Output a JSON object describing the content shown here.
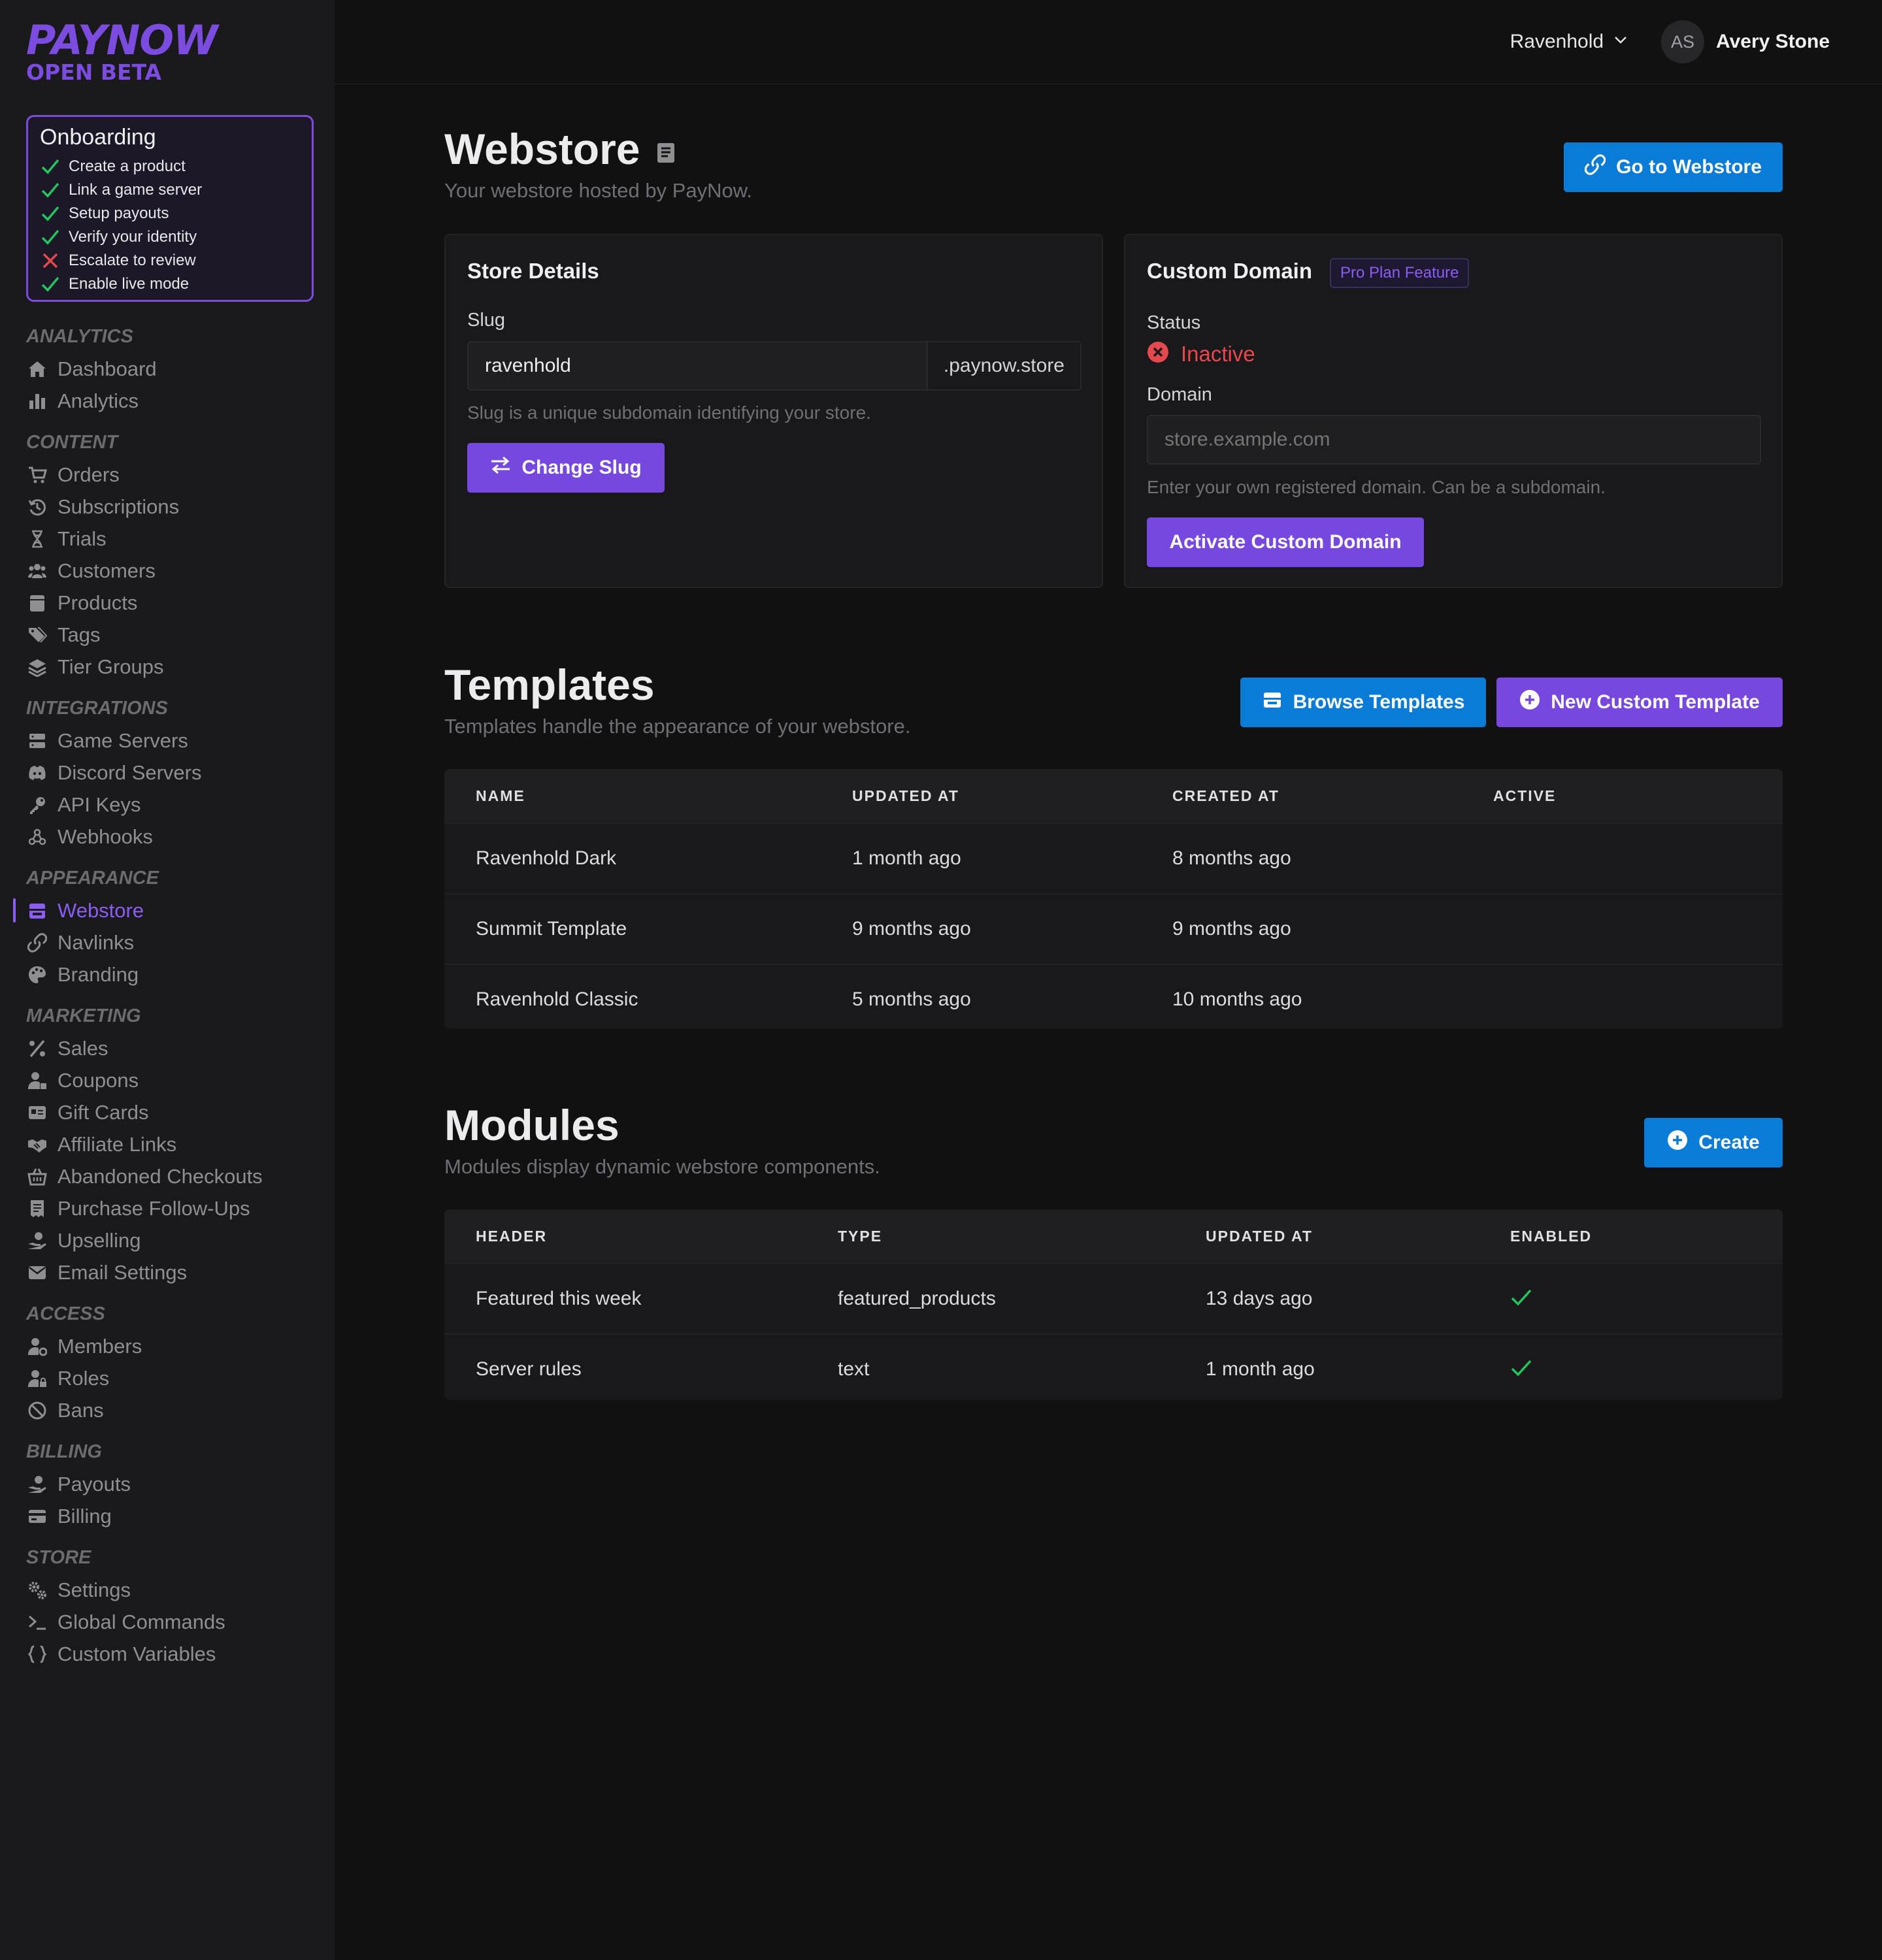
{
  "brand": {
    "name": "PAYNOW",
    "tag": "OPEN BETA"
  },
  "onboarding": {
    "title": "Onboarding",
    "steps": [
      {
        "label": "Create a product",
        "done": true
      },
      {
        "label": "Link a game server",
        "done": true
      },
      {
        "label": "Setup payouts",
        "done": true
      },
      {
        "label": "Verify your identity",
        "done": true
      },
      {
        "label": "Escalate to review",
        "done": false
      },
      {
        "label": "Enable live mode",
        "done": true
      }
    ]
  },
  "nav": {
    "analytics": {
      "title": "ANALYTICS",
      "items": [
        "Dashboard",
        "Analytics"
      ]
    },
    "content": {
      "title": "CONTENT",
      "items": [
        "Orders",
        "Subscriptions",
        "Trials",
        "Customers",
        "Products",
        "Tags",
        "Tier Groups"
      ]
    },
    "integrations": {
      "title": "INTEGRATIONS",
      "items": [
        "Game Servers",
        "Discord Servers",
        "API Keys",
        "Webhooks"
      ]
    },
    "appearance": {
      "title": "APPEARANCE",
      "items": [
        "Webstore",
        "Navlinks",
        "Branding"
      ],
      "active": "Webstore"
    },
    "marketing": {
      "title": "MARKETING",
      "items": [
        "Sales",
        "Coupons",
        "Gift Cards",
        "Affiliate Links",
        "Abandoned Checkouts",
        "Purchase Follow-Ups",
        "Upselling",
        "Email Settings"
      ]
    },
    "access": {
      "title": "ACCESS",
      "items": [
        "Members",
        "Roles",
        "Bans"
      ]
    },
    "billing": {
      "title": "BILLING",
      "items": [
        "Payouts",
        "Billing"
      ]
    },
    "store": {
      "title": "STORE",
      "items": [
        "Settings",
        "Global Commands",
        "Custom Variables"
      ]
    }
  },
  "header": {
    "store": "Ravenhold",
    "avatar_initials": "AS",
    "user": "Avery Stone"
  },
  "page": {
    "title": "Webstore",
    "subtitle": "Your webstore hosted by PayNow.",
    "go_button": "Go to Webstore"
  },
  "store_details": {
    "title": "Store Details",
    "slug_label": "Slug",
    "slug_value": "ravenhold",
    "slug_suffix": ".paynow.store",
    "slug_help": "Slug is a unique subdomain identifying your store.",
    "change_button": "Change Slug"
  },
  "custom_domain": {
    "title": "Custom Domain",
    "badge": "Pro Plan Feature",
    "status_label": "Status",
    "status_value": "Inactive",
    "domain_label": "Domain",
    "domain_placeholder": "store.example.com",
    "domain_help": "Enter your own registered domain. Can be a subdomain.",
    "activate_button": "Activate Custom Domain"
  },
  "templates": {
    "title": "Templates",
    "subtitle": "Templates handle the appearance of your webstore.",
    "browse_button": "Browse Templates",
    "new_button": "New Custom Template",
    "columns": [
      "NAME",
      "UPDATED AT",
      "CREATED AT",
      "ACTIVE"
    ],
    "rows": [
      {
        "name": "Ravenhold Dark",
        "updated": "1 month ago",
        "created": "8 months ago"
      },
      {
        "name": "Summit Template",
        "updated": "9 months ago",
        "created": "9 months ago"
      },
      {
        "name": "Ravenhold Classic",
        "updated": "5 months ago",
        "created": "10 months ago"
      }
    ]
  },
  "modules": {
    "title": "Modules",
    "subtitle": "Modules display dynamic webstore components.",
    "create_button": "Create",
    "columns": [
      "HEADER",
      "TYPE",
      "UPDATED AT",
      "ENABLED"
    ],
    "rows": [
      {
        "header": "Featured this week",
        "type": "featured_products",
        "updated": "13 days ago",
        "enabled": true
      },
      {
        "header": "Server rules",
        "type": "text",
        "updated": "1 month ago",
        "enabled": true
      }
    ]
  },
  "colors": {
    "accent": "#7748e0",
    "blue": "#0b7bd8",
    "danger": "#e5484d",
    "success": "#22c55e"
  }
}
